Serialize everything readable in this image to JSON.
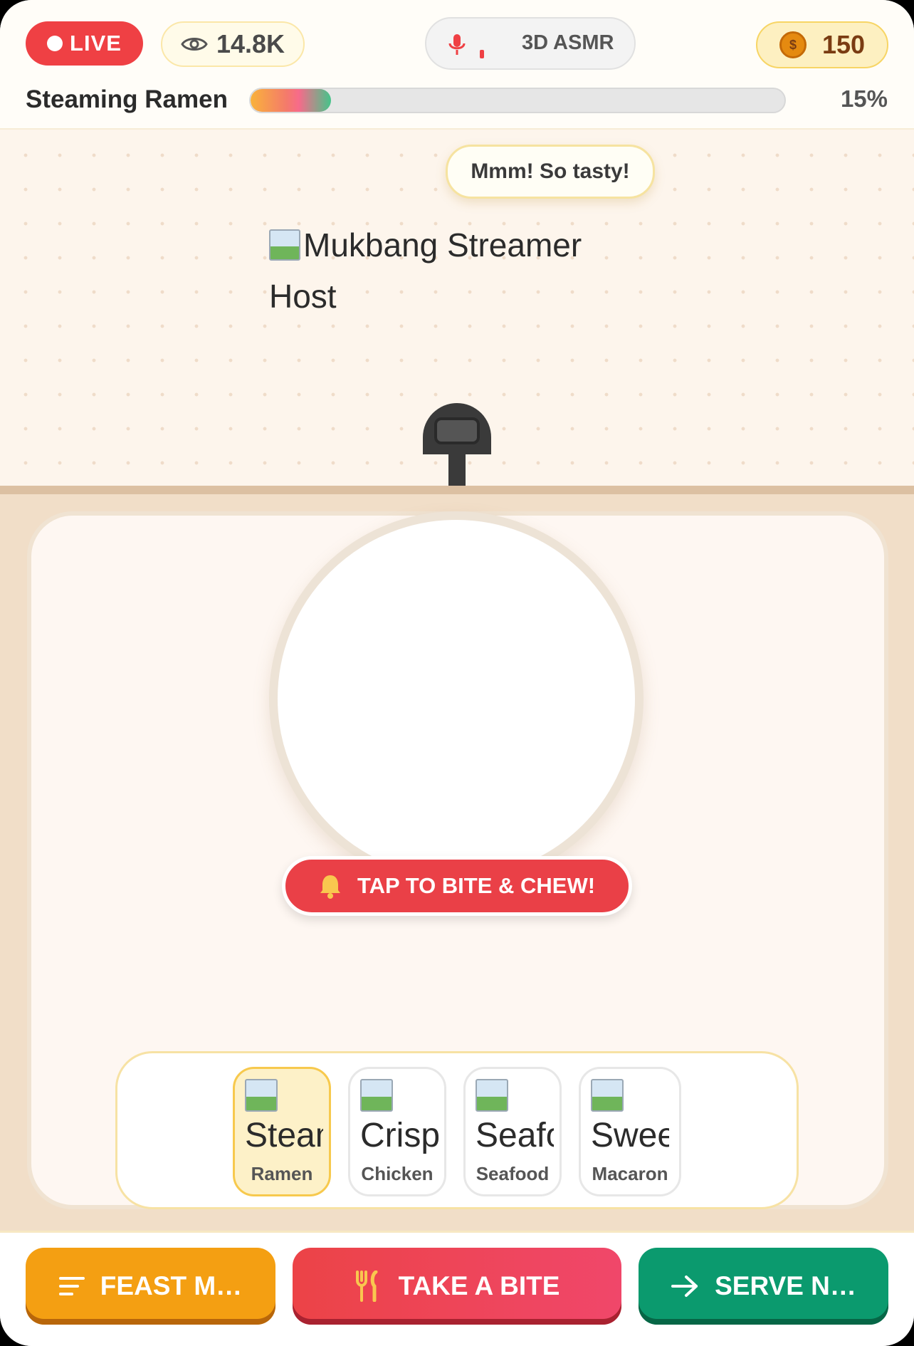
{
  "header": {
    "live_label": "LIVE",
    "viewers": "14.8K",
    "audio_mode": "3D ASMR",
    "coins": "150",
    "coin_symbol": "$"
  },
  "dish": {
    "title": "Steaming Ramen",
    "progress_percent": 15,
    "progress_label": "15%"
  },
  "stage": {
    "speech": "Mmm! So tasty!",
    "host_alt": "Mukbang Streamer Host"
  },
  "table": {
    "hint": "TAP TO BITE & CHEW!",
    "dishes": [
      {
        "alt": "Steaming Ramen",
        "name": "Ramen",
        "selected": true
      },
      {
        "alt": "Crispy Chicken",
        "name": "Chicken",
        "selected": false
      },
      {
        "alt": "Seafood",
        "name": "Seafood",
        "selected": false
      },
      {
        "alt": "Sweet Macaron",
        "name": "Macaron",
        "selected": false
      }
    ]
  },
  "actions": {
    "menu_label": "FEAST M…",
    "bite_label": "TAKE A BITE",
    "next_label": "SERVE N…"
  },
  "colors": {
    "live_red": "#ef4044",
    "menu_orange": "#f49f12",
    "bite_red": "#ec4347",
    "next_green": "#0b9a6e",
    "coin_gold": "#e58a10"
  },
  "icons": {
    "viewers": "eye-icon",
    "audio": "microphone-icon",
    "coin": "coin-icon",
    "hint": "bell-icon",
    "menu": "menu-lines-icon",
    "bite": "fork-knife-icon",
    "next": "arrow-right-icon"
  }
}
